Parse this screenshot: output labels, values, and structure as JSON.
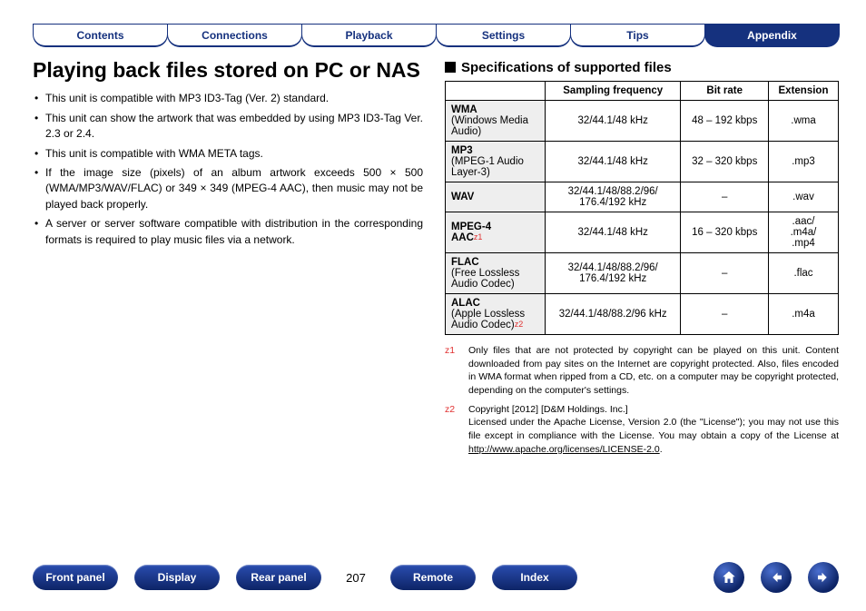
{
  "tabs": [
    "Contents",
    "Connections",
    "Playback",
    "Settings",
    "Tips",
    "Appendix"
  ],
  "active_tab_index": 5,
  "page_title": "Playing back files stored on PC or NAS",
  "bullets": [
    "This unit is compatible with MP3 ID3-Tag (Ver. 2) standard.",
    "This unit can show the artwork that was embedded by using MP3 ID3-Tag Ver. 2.3 or 2.4.",
    "This unit is compatible with WMA META tags.",
    "If the image size (pixels) of an album artwork exceeds 500 × 500 (WMA/MP3/WAV/FLAC) or 349 × 349 (MPEG-4 AAC), then music may not be played back properly.",
    "A server or server software compatible with distribution in the corresponding formats is required to play music files via a network."
  ],
  "section_title": "Specifications of supported files",
  "table": {
    "headers": [
      "Sampling frequency",
      "Bit rate",
      "Extension"
    ],
    "rows": [
      {
        "fmt_bold": "WMA",
        "fmt_sub": "(Windows Media Audio)",
        "star": "",
        "freq": "32/44.1/48 kHz",
        "bitrate": "48 – 192 kbps",
        "ext": ".wma"
      },
      {
        "fmt_bold": "MP3",
        "fmt_sub": "(MPEG-1 Audio Layer-3)",
        "star": "",
        "freq": "32/44.1/48 kHz",
        "bitrate": "32 – 320 kbps",
        "ext": ".mp3"
      },
      {
        "fmt_bold": "WAV",
        "fmt_sub": "",
        "star": "",
        "freq": "32/44.1/48/88.2/96/\n176.4/192 kHz",
        "bitrate": "–",
        "ext": ".wav"
      },
      {
        "fmt_bold": "MPEG-4 AAC",
        "fmt_sub": "",
        "star": "1",
        "freq": "32/44.1/48 kHz",
        "bitrate": "16 – 320 kbps",
        "ext": ".aac/\n.m4a/\n.mp4"
      },
      {
        "fmt_bold": "FLAC",
        "fmt_sub": "(Free Lossless Audio Codec)",
        "star": "",
        "freq": "32/44.1/48/88.2/96/\n176.4/192 kHz",
        "bitrate": "–",
        "ext": ".flac"
      },
      {
        "fmt_bold": "ALAC",
        "fmt_sub": "(Apple Lossless Audio Codec)",
        "star": "2",
        "freq": "32/44.1/48/88.2/96 kHz",
        "bitrate": "–",
        "ext": ".m4a"
      }
    ]
  },
  "notes": [
    {
      "marker": "z1",
      "text": "Only files that are not protected by copyright can be played on this unit. Content downloaded from pay sites on the Internet are copyright protected. Also, files encoded in WMA format when ripped from a CD, etc. on a computer may be copyright protected, depending on the computer's settings."
    },
    {
      "marker": "z2",
      "text": "Copyright [2012] [D&M Holdings. Inc.]\nLicensed under the Apache License, Version 2.0 (the \"License\"); you may not use this file except in compliance with the License. You may obtain a copy of the License at ",
      "link_text": "http://www.apache.org/licenses/LICENSE-2.0",
      "tail": "."
    }
  ],
  "bottom_buttons_left": [
    "Front panel",
    "Display",
    "Rear panel"
  ],
  "page_number": "207",
  "bottom_buttons_right": [
    "Remote",
    "Index"
  ]
}
